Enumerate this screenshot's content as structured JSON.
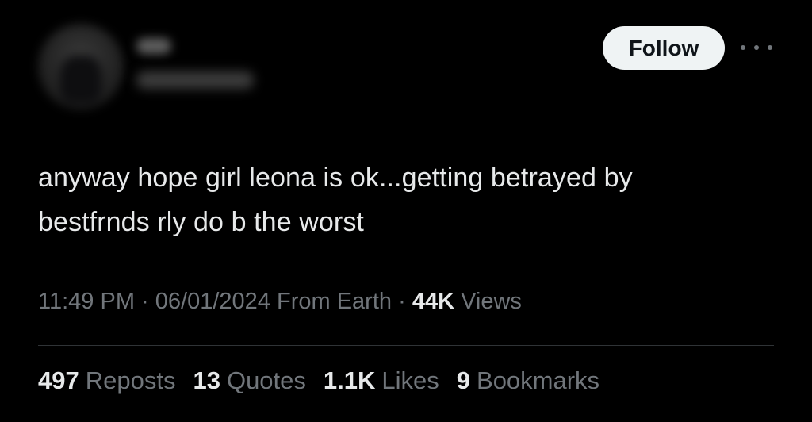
{
  "header": {
    "follow_label": "Follow",
    "more_icon": "more-horizontal-icon"
  },
  "tweet": {
    "text_line1": "anyway hope girl leona is ok...getting betrayed by",
    "text_line2": "bestfrnds rly do b the worst"
  },
  "meta": {
    "time": "11:49 PM",
    "separator": "·",
    "date": "06/01/2024",
    "source": "From Earth",
    "views_count": "44K",
    "views_label": "Views"
  },
  "stats": [
    {
      "count": "497",
      "label": "Reposts"
    },
    {
      "count": "13",
      "label": "Quotes"
    },
    {
      "count": "1.1K",
      "label": "Likes"
    },
    {
      "count": "9",
      "label": "Bookmarks"
    }
  ],
  "colors": {
    "background": "#000000",
    "text_primary": "#e7e9ea",
    "text_secondary": "#71767b",
    "follow_bg": "#eff3f4",
    "divider": "#2f3336"
  }
}
